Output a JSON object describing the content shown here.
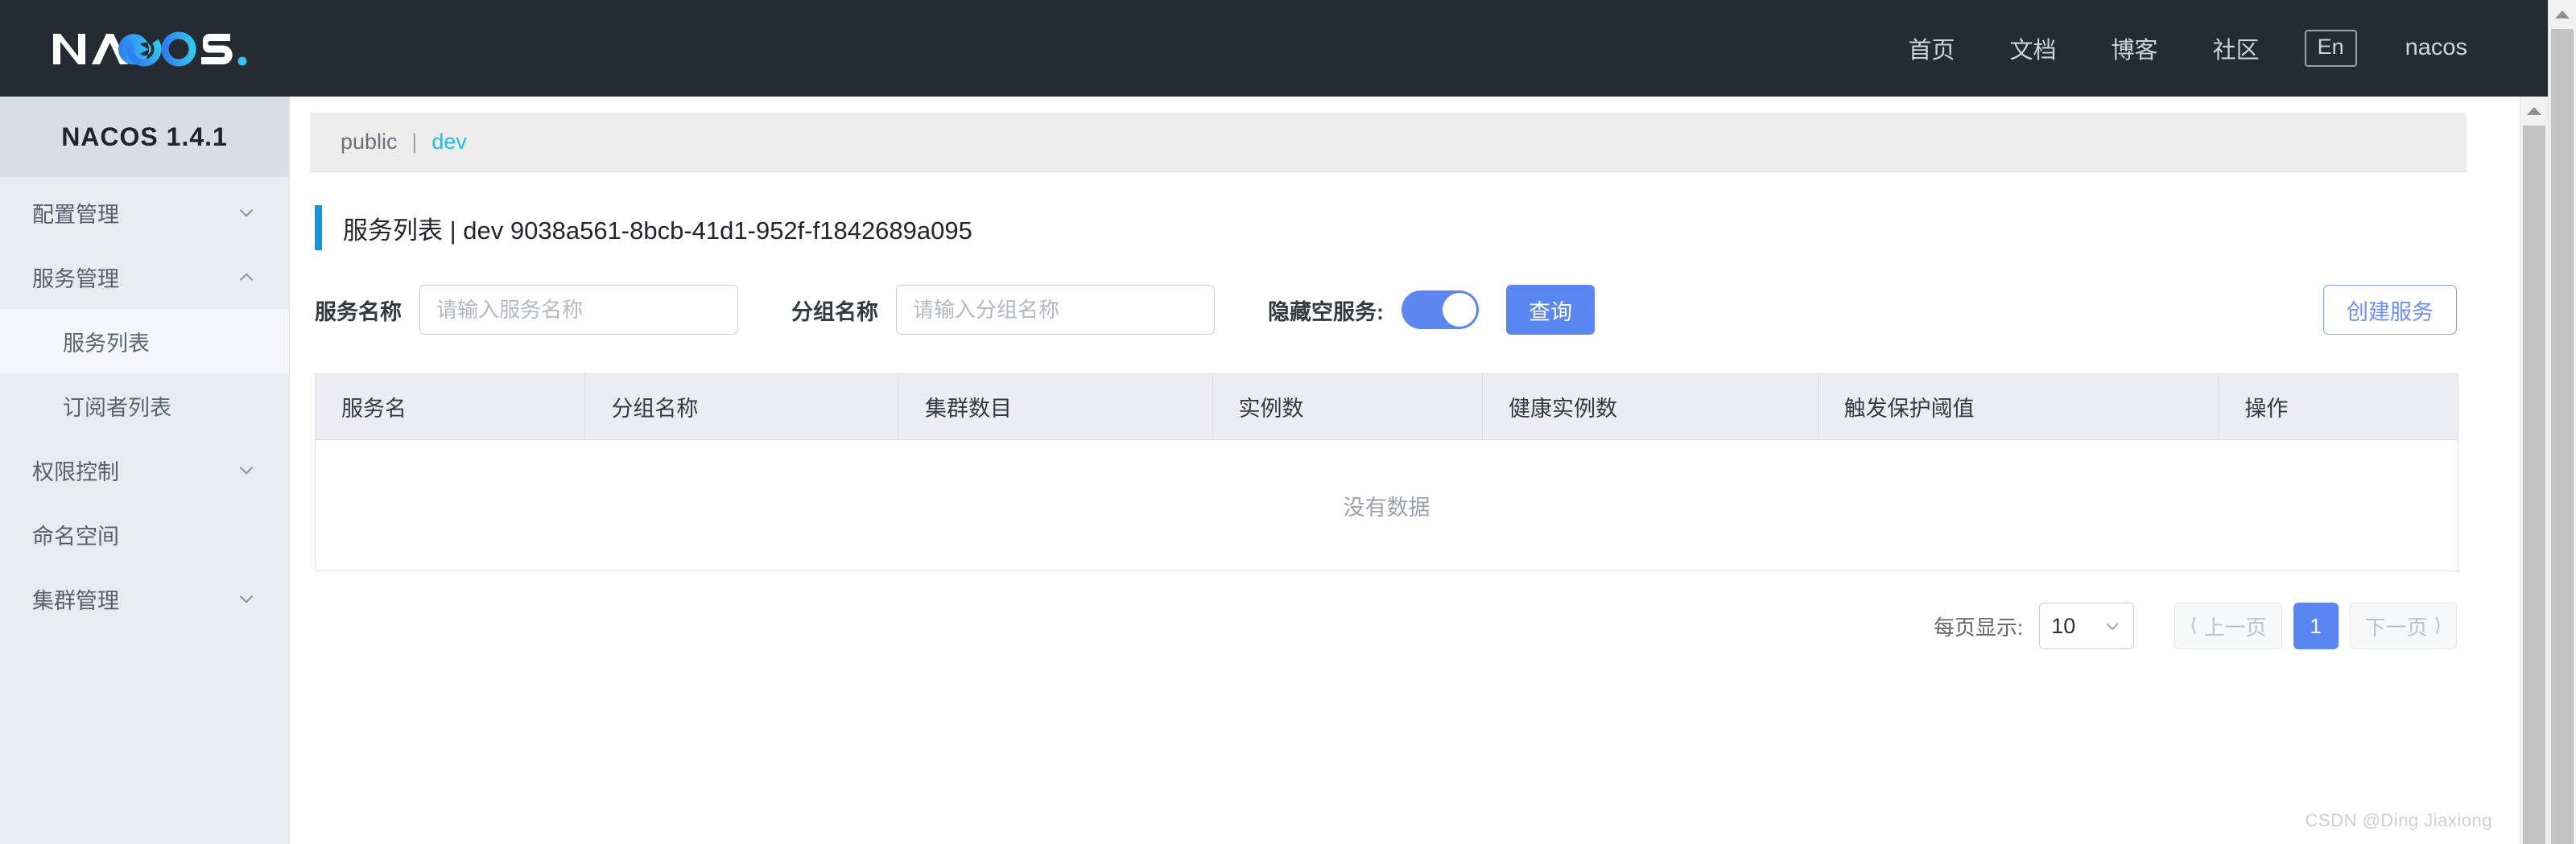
{
  "header": {
    "logo_text": "NACOS.",
    "nav": [
      {
        "label": "首页",
        "name": "home"
      },
      {
        "label": "文档",
        "name": "docs"
      },
      {
        "label": "博客",
        "name": "blog"
      },
      {
        "label": "社区",
        "name": "community"
      }
    ],
    "lang_toggle": "En",
    "user": "nacos",
    "bg_color": "#252b32"
  },
  "sidebar": {
    "title": "NACOS 1.4.1",
    "items": [
      {
        "label": "配置管理",
        "icon": "chevron-down-icon",
        "level": "top",
        "active": false
      },
      {
        "label": "服务管理",
        "icon": "chevron-up-icon",
        "level": "top",
        "active": false
      },
      {
        "label": "服务列表",
        "icon": "",
        "level": "sub",
        "active": true
      },
      {
        "label": "订阅者列表",
        "icon": "",
        "level": "sub",
        "active": false
      },
      {
        "label": "权限控制",
        "icon": "chevron-down-icon",
        "level": "top",
        "active": false
      },
      {
        "label": "命名空间",
        "icon": "",
        "level": "top",
        "active": false
      },
      {
        "label": "集群管理",
        "icon": "chevron-down-icon",
        "level": "top",
        "active": false
      }
    ]
  },
  "breadcrumb": {
    "namespace": "public",
    "separator": "|",
    "current": "dev",
    "current_color": "#17c0e8"
  },
  "page": {
    "title": "服务列表  |  dev  9038a561-8bcb-41d1-952f-f1842689a095",
    "accent_color": "#1296db"
  },
  "filters": {
    "service_name_label": "服务名称",
    "service_name_placeholder": "请输入服务名称",
    "service_name_value": "",
    "group_name_label": "分组名称",
    "group_name_placeholder": "请输入分组名称",
    "group_name_value": "",
    "hide_empty_label": "隐藏空服务:",
    "hide_empty_on": true,
    "query_button": "查询",
    "create_button": "创建服务",
    "primary_color": "#5a86f2"
  },
  "table": {
    "columns": [
      "服务名",
      "分组名称",
      "集群数目",
      "实例数",
      "健康实例数",
      "触发保护阈值",
      "操作"
    ],
    "rows": [],
    "empty_text": "没有数据"
  },
  "pagination": {
    "page_size_label": "每页显示:",
    "page_size_value": "10",
    "prev_label": "上一页",
    "next_label": "下一页",
    "current_page": "1"
  },
  "watermark": "CSDN @Ding Jiaxiong"
}
